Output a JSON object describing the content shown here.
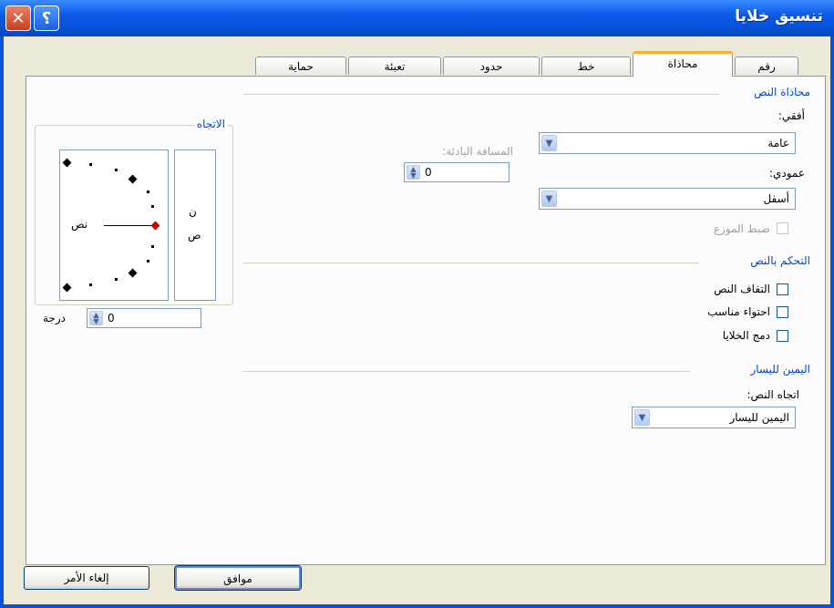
{
  "window": {
    "title": "تنسيق خلايا",
    "close_icon": "close-icon",
    "help_label": "؟"
  },
  "tabs": [
    {
      "label": "رقم"
    },
    {
      "label": "محاذاة"
    },
    {
      "label": "خط"
    },
    {
      "label": "حدود"
    },
    {
      "label": "تعبئة"
    },
    {
      "label": "حماية"
    }
  ],
  "alignment": {
    "section_label": "محاذاة النص",
    "horizontal_label": "أفقي:",
    "horizontal_value": "عامة",
    "vertical_label": "عمودي:",
    "vertical_value": "أسفل",
    "indent_label": "المسافة البادئة:",
    "indent_value": "0",
    "justify_distributed_label": "ضبط الموزع"
  },
  "text_control": {
    "section_label": "التحكم بالنص",
    "wrap_text": "التفاف النص",
    "shrink_to_fit": "احتواء مناسب",
    "merge_cells": "دمج الخلايا"
  },
  "rtl": {
    "section_label": "اليمين لليسار",
    "direction_label": "اتجاه النص:",
    "direction_value": "اليمين لليسار"
  },
  "orientation": {
    "label": "الاتجاه",
    "vertical_text_1": "ن",
    "vertical_text_2": "ص",
    "text_label": "نص",
    "degrees_label": "درجة",
    "degrees_value": "0",
    "marker_color": "#c00000"
  },
  "buttons": {
    "ok": "موافق",
    "cancel": "إلغاء الأمر"
  }
}
